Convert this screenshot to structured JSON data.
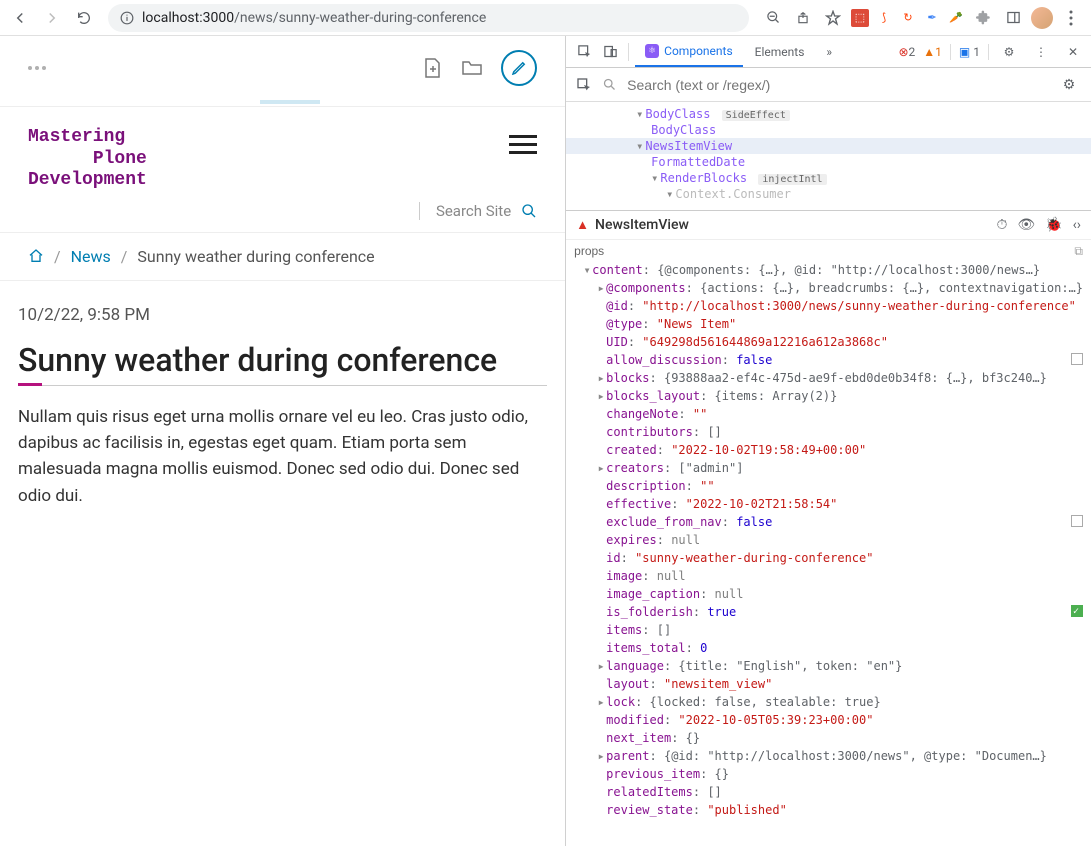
{
  "browser": {
    "url_host": "localhost:",
    "url_port": "3000",
    "url_path": "/news/sunny-weather-during-conference",
    "errors": "2",
    "warnings": "1",
    "messages": "1"
  },
  "devtools": {
    "tab_components": "Components",
    "tab_elements": "Elements",
    "search_placeholder": "Search (text or /regex/)",
    "tree": {
      "bodyclass": "BodyClass",
      "sideeffect_tag": "SideEffect",
      "bodyclass2": "BodyClass",
      "newsitemview": "NewsItemView",
      "formatteddate": "FormattedDate",
      "renderblocks": "RenderBlocks",
      "injectintl_tag": "injectIntl",
      "contextconsumer": "Context.Consumer"
    },
    "inspector_title": "NewsItemView",
    "props_label": "props"
  },
  "plone": {
    "logo_line1": "Mastering",
    "logo_line2": "Plone",
    "logo_line3": "Development",
    "search_placeholder": "Search Site",
    "breadcrumb_home": "Home",
    "breadcrumb_news": "News",
    "breadcrumb_current": "Sunny weather during conference",
    "date": "10/2/22, 9:58 PM",
    "title": "Sunny weather during conference",
    "body": "Nullam quis risus eget urna mollis ornare vel eu leo. Cras justo odio, dapibus ac facilisis in, egestas eget quam. Etiam porta sem malesuada magna mollis euismod. Donec sed odio dui. Donec sed odio dui."
  },
  "props": {
    "content_key": "content",
    "content_summary": "{@components: {…}, @id: \"http://localhost:3000/news…}",
    "components_key": "@components",
    "components_val": "{actions: {…}, breadcrumbs: {…}, contextnavigation:…}",
    "id_key": "@id",
    "id_val": "http://localhost:3000/news/sunny-weather-during-conference",
    "type_key": "@type",
    "type_val": "News Item",
    "uid_key": "UID",
    "uid_val": "649298d561644869a12216a612a3868c",
    "allow_discussion_key": "allow_discussion",
    "allow_discussion_val": "false",
    "blocks_key": "blocks",
    "blocks_val": "{93888aa2-ef4c-475d-ae9f-ebd0de0b34f8: {…}, bf3c240…}",
    "blocks_layout_key": "blocks_layout",
    "blocks_layout_val": "{items: Array(2)}",
    "changenote_key": "changeNote",
    "changenote_val": "",
    "contributors_key": "contributors",
    "contributors_val": "[]",
    "created_key": "created",
    "created_val": "2022-10-02T19:58:49+00:00",
    "creators_key": "creators",
    "creators_val": "[\"admin\"]",
    "description_key": "description",
    "description_val": "",
    "effective_key": "effective",
    "effective_val": "2022-10-02T21:58:54",
    "exclude_key": "exclude_from_nav",
    "exclude_val": "false",
    "expires_key": "expires",
    "expires_val": "null",
    "sid_key": "id",
    "sid_val": "sunny-weather-during-conference",
    "image_key": "image",
    "image_val": "null",
    "image_caption_key": "image_caption",
    "image_caption_val": "null",
    "is_folderish_key": "is_folderish",
    "is_folderish_val": "true",
    "items_key": "items",
    "items_val": "[]",
    "items_total_key": "items_total",
    "items_total_val": "0",
    "language_key": "language",
    "language_val": "{title: \"English\", token: \"en\"}",
    "layout_key": "layout",
    "layout_val": "newsitem_view",
    "lock_key": "lock",
    "lock_val": "{locked: false, stealable: true}",
    "modified_key": "modified",
    "modified_val": "2022-10-05T05:39:23+00:00",
    "next_item_key": "next_item",
    "next_item_val": "{}",
    "parent_key": "parent",
    "parent_val": "{@id: \"http://localhost:3000/news\", @type: \"Documen…}",
    "previous_item_key": "previous_item",
    "previous_item_val": "{}",
    "related_key": "relatedItems",
    "related_val": "[]",
    "review_state_key": "review_state",
    "review_state_val": "published"
  }
}
